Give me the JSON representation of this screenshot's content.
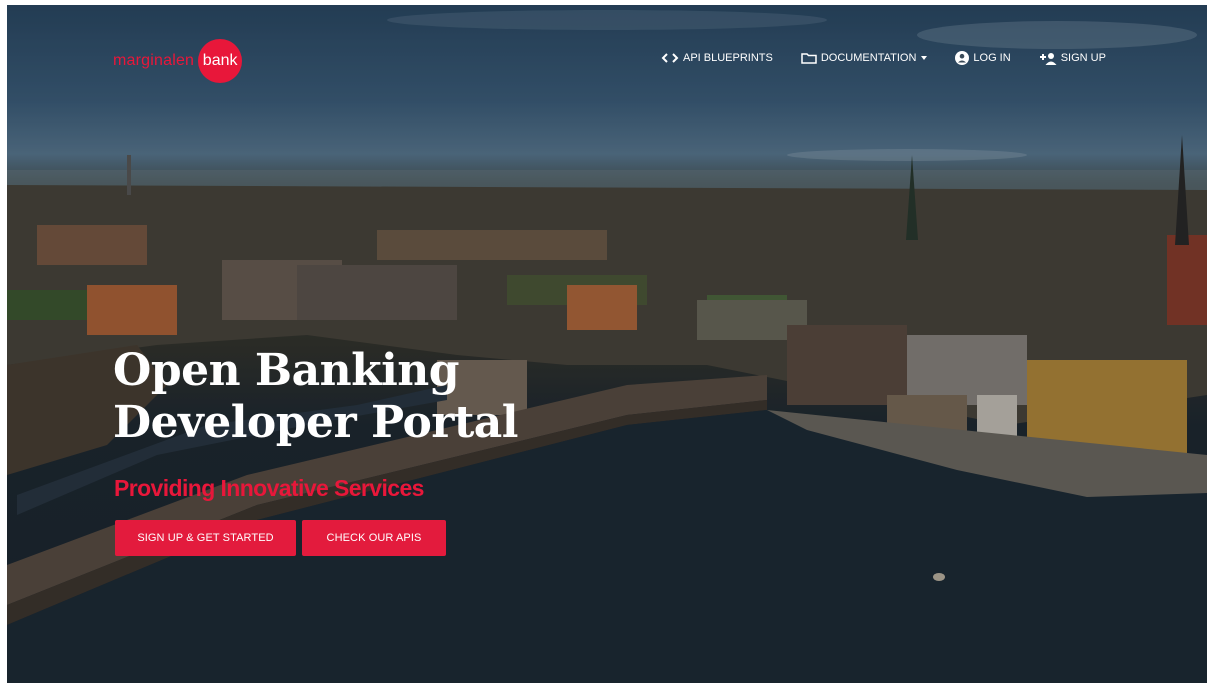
{
  "brand": {
    "name_part1": "marginalen",
    "name_part2": "bank",
    "accent_color": "#e8173a"
  },
  "nav": {
    "items": [
      {
        "label": "API BLUEPRINTS",
        "icon": "code-icon"
      },
      {
        "label": "DOCUMENTATION",
        "icon": "folder-icon",
        "has_dropdown": true
      },
      {
        "label": "LOG IN",
        "icon": "user-circle-icon"
      },
      {
        "label": "SIGN UP",
        "icon": "user-plus-icon"
      }
    ]
  },
  "hero": {
    "title_line1": "Open Banking",
    "title_line2": "Developer Portal",
    "tagline": "Providing Innovative Services",
    "primary_button": "SIGN UP & GET STARTED",
    "secondary_button": "CHECK OUR APIS"
  }
}
